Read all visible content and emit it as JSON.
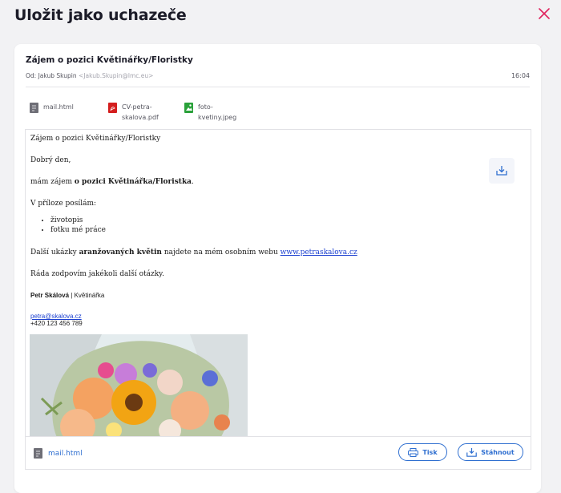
{
  "modal": {
    "title": "Uložit jako uchazeče"
  },
  "email": {
    "subject": "Zájem o pozici Květinářky/Floristky",
    "from_label": "Od:",
    "from_name": "Jakub Skupin",
    "from_email": "<Jakub.Skupin@lmc.eu>",
    "time": "16:04"
  },
  "attachments": [
    {
      "name_line1": "mail.html",
      "name_line2": "",
      "type": "html",
      "color": "#6e6e76"
    },
    {
      "name_line1": "CV-petra-",
      "name_line2": "skalova.pdf",
      "type": "pdf",
      "color": "#d41e1e"
    },
    {
      "name_line1": "foto-",
      "name_line2": "kvetiny.jpeg",
      "type": "image",
      "color": "#2aa13a"
    }
  ],
  "body": {
    "heading": "Zájem o pozici Květinářky/Floristky",
    "greeting": "Dobrý den,",
    "interest_prefix": "mám zájem ",
    "interest_bold": "o pozici Květinářka/Floristka",
    "interest_suffix": ".",
    "attachments_intro": "V příloze posílám:",
    "list": [
      "životopis",
      "fotku mé práce"
    ],
    "portfolio_prefix": "Další ukázky ",
    "portfolio_bold": "aranžovaných květin",
    "portfolio_middle": " najdete na mém osobním webu ",
    "portfolio_link": "www.petraskalova.cz",
    "closing": "Ráda zodpovím jakékoli další otázky.",
    "signature_name": "Petr Skálová",
    "signature_sep": " | ",
    "signature_role": "Květinářka",
    "signature_email": "petra@skalova.cz",
    "signature_phone": "+420 123 456 789"
  },
  "footer": {
    "file_name": "mail.html",
    "print_label": "Tisk",
    "download_label": "Stáhnout"
  },
  "colors": {
    "accent": "#2f6fd0",
    "close": "#e0245e",
    "pdf": "#d41e1e",
    "image": "#2aa13a"
  }
}
